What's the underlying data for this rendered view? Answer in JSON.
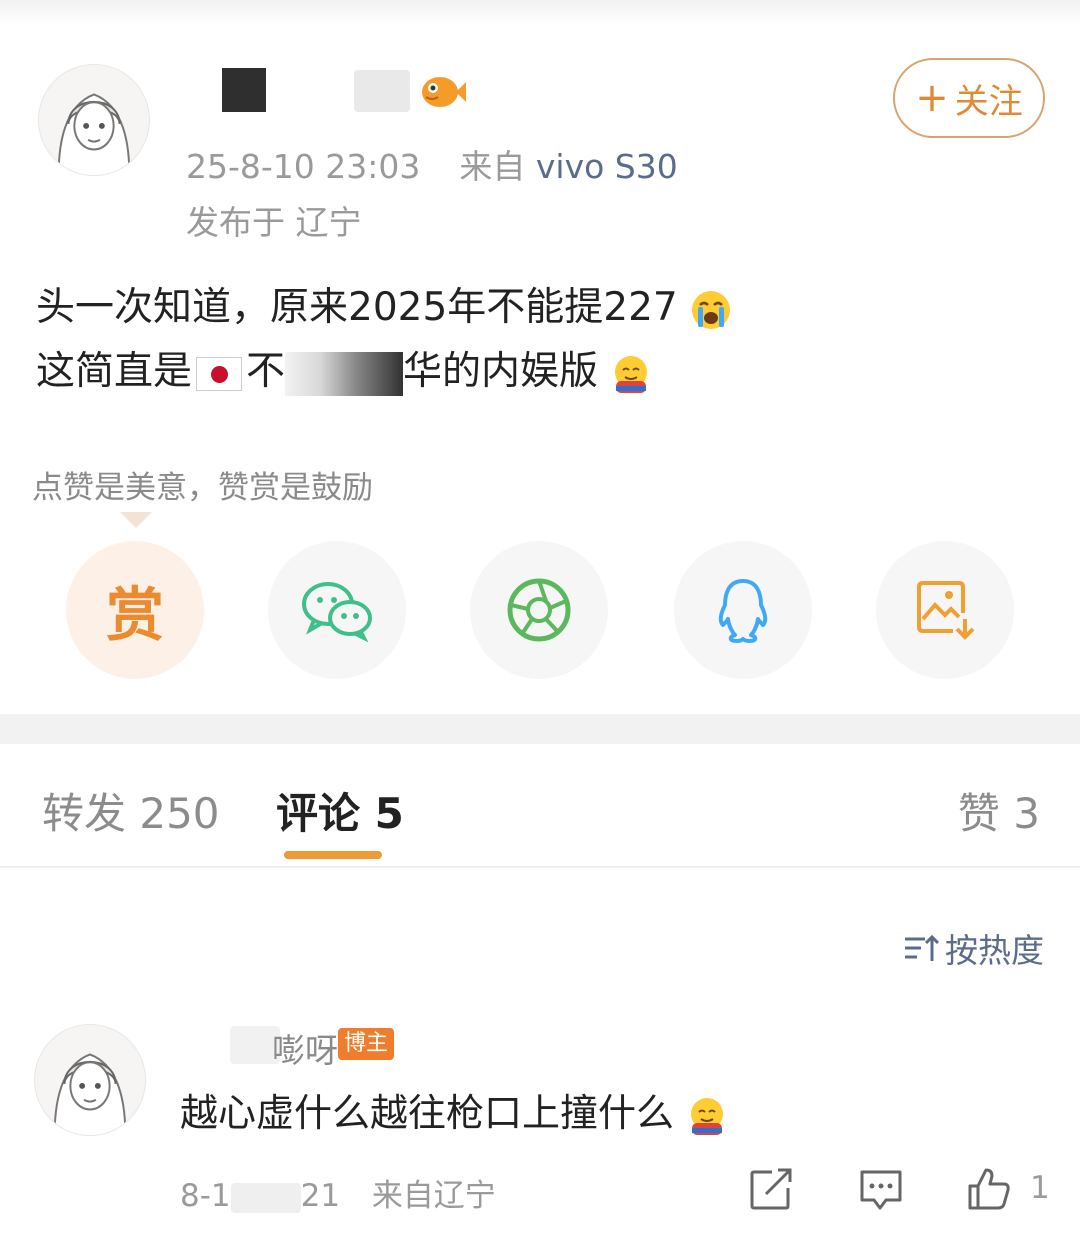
{
  "post": {
    "timestamp": "25-8-10 23:03",
    "source_prefix": "来自",
    "device": "vivo S30",
    "location": "发布于 辽宁",
    "follow_label": "关注",
    "text_line1": "头一次知道，原来2025年不能提227",
    "text_line2_a": "这简直是",
    "text_line2_b": "不",
    "text_line2_c": "华的内娱版"
  },
  "reward": {
    "tip": "点赞是美意，赞赏是鼓励",
    "reward_char": "赏"
  },
  "share": {
    "items": [
      "reward",
      "wechat-icon",
      "moments-icon",
      "qq-icon",
      "save-image-icon"
    ]
  },
  "tabs": {
    "repost": "转发 250",
    "comments": "评论 5",
    "likes": "赞 3"
  },
  "sort": {
    "label": "按热度"
  },
  "comment": {
    "name_suffix": "嘭呀",
    "badge": "博主",
    "text": "越心虚什么越往枪口上撞什么",
    "date_partial": "8-1",
    "time_partial": "21",
    "location": "来自辽宁",
    "like_count": "1"
  },
  "colors": {
    "accent_orange": "#f09a35",
    "link_blue": "#5b6b8c",
    "wechat_green": "#3fbf8a",
    "moments_green": "#5cb85c",
    "qq_blue": "#3fa9f5"
  }
}
